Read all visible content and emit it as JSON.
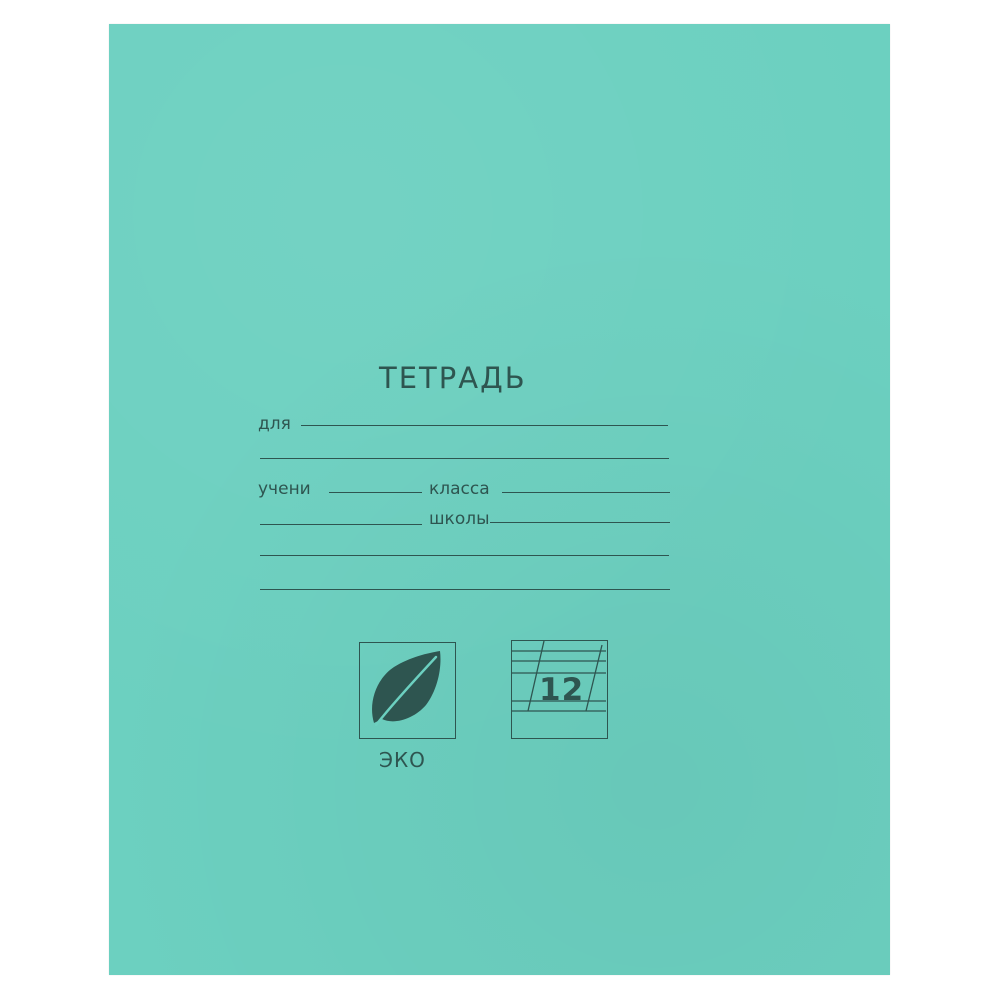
{
  "cover": {
    "title": "ТЕТРАДЬ",
    "background_color": "#6cd0c0",
    "ink_color": "#2e5550"
  },
  "form": {
    "for_label": "для",
    "student_label": "учени",
    "class_label": "класса",
    "school_label": "школы"
  },
  "eco_logo": {
    "icon": "leaf-icon",
    "label": "ЭКО"
  },
  "sheets_badge": {
    "icon": "lined-paper-icon",
    "count": "12"
  }
}
